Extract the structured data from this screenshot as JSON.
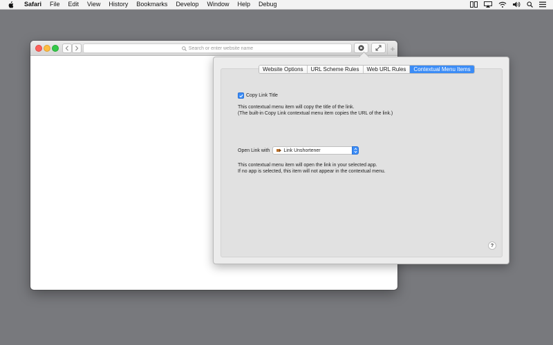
{
  "menubar": {
    "app_name": "Safari",
    "items": [
      "File",
      "Edit",
      "View",
      "History",
      "Bookmarks",
      "Develop",
      "Window",
      "Help",
      "Debug"
    ],
    "status_icons": [
      "screen-mirror-icon",
      "airplay-icon",
      "wifi-icon",
      "volume-icon",
      "spotlight-search-icon",
      "notification-center-icon"
    ]
  },
  "safari": {
    "address_placeholder": "Search or enter website name"
  },
  "popover": {
    "tabs": [
      "Website Options",
      "URL Scheme Rules",
      "Web URL Rules",
      "Contextual Menu Items"
    ],
    "active_tab_index": 3,
    "copy_link": {
      "checked": true,
      "label": "Copy Link Title",
      "desc_line1": "This contextual menu item will copy the title of the link.",
      "desc_line2": "(The built-in Copy Link contextual menu item copies the URL of the link.)"
    },
    "open_link": {
      "label": "Open Link with",
      "selected_app": "Link Unshortener",
      "desc_line1": "This contextual menu item will open the link in your selected app.",
      "desc_line2": "If no app is selected, this item will not appear in the contextual menu."
    },
    "help_label": "?"
  },
  "colors": {
    "desktop": "#78797d",
    "accent": "#3b8cf6"
  }
}
